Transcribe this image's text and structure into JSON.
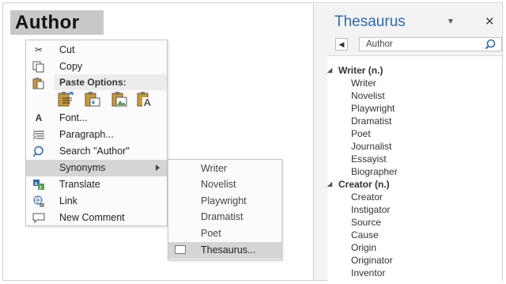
{
  "document": {
    "selected_word": "Author"
  },
  "context_menu": {
    "cut": "Cut",
    "copy": "Copy",
    "paste_options_header": "Paste Options:",
    "font": "Font...",
    "paragraph": "Paragraph...",
    "search": "Search \"Author\"",
    "synonyms": "Synonyms",
    "translate": "Translate",
    "link": "Link",
    "new_comment": "New Comment"
  },
  "synonyms_submenu": {
    "items": [
      "Writer",
      "Novelist",
      "Playwright",
      "Dramatist",
      "Poet"
    ],
    "thesaurus": "Thesaurus..."
  },
  "thesaurus_pane": {
    "title": "Thesaurus",
    "search_value": "Author",
    "groups": [
      {
        "title": "Writer (n.)",
        "items": [
          "Writer",
          "Novelist",
          "Playwright",
          "Dramatist",
          "Poet",
          "Journalist",
          "Essayist",
          "Biographer"
        ]
      },
      {
        "title": "Creator (n.)",
        "items": [
          "Creator",
          "Instigator",
          "Source",
          "Cause",
          "Origin",
          "Originator",
          "Inventor"
        ]
      }
    ]
  },
  "colors": {
    "accent": "#2e6ab0",
    "selection": "#d5d5d5",
    "word_highlight": "#c8c8c8"
  }
}
